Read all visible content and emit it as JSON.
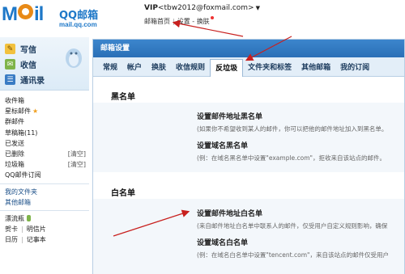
{
  "header": {
    "logo_text": "MAIL",
    "logo_qq": "QQ邮箱",
    "logo_domain": "mail.qq.com",
    "vip_label": "VIP",
    "account_email": "<tbw2012@foxmail.com>",
    "links": [
      "邮箱首页",
      "设置",
      "换肤"
    ]
  },
  "sidebar": {
    "quick": [
      "写信",
      "收信",
      "通讯录"
    ],
    "folders": [
      {
        "label": "收件箱"
      },
      {
        "label": "星标邮件",
        "star": "★"
      },
      {
        "label": "群邮件"
      },
      {
        "label": "草稿箱(11)"
      },
      {
        "label": "已发送"
      },
      {
        "label": "已删除",
        "action": "[清空]"
      },
      {
        "label": "垃圾箱",
        "action": "[清空]"
      },
      {
        "label": "QQ邮件订阅"
      }
    ],
    "my_folders": [
      "我的文件夹",
      "其他邮箱"
    ],
    "extras": {
      "drift": "漂流瓶",
      "card": "贺卡",
      "postcard": "明信片",
      "calendar": "日历",
      "notes": "记事本"
    }
  },
  "main": {
    "title": "邮箱设置",
    "tabs": [
      "常规",
      "帐户",
      "换肤",
      "收信规则",
      "反垃圾",
      "文件夹和标签",
      "其他邮箱",
      "我的订阅"
    ],
    "active_tab": "反垃圾",
    "blacklist": {
      "heading": "黑名单",
      "addr_title": "设置邮件地址黑名单",
      "addr_desc": "(如果你不希望收到某人的邮件，你可以把他的邮件地址加入到黑名单。",
      "domain_title": "设置域名黑名单",
      "domain_desc": "(例：在域名黑名单中设置\"example.com\"，拒收来自该站点的邮件。"
    },
    "whitelist": {
      "heading": "白名单",
      "addr_title": "设置邮件地址白名单",
      "addr_desc": "(来自邮件地址白名单中联系人的邮件，仅受用户自定义规则影响，确保",
      "domain_title": "设置域名白名单",
      "domain_desc": "(例：在域名白名单中设置\"tencent.com\"，来自该站点的邮件仅受用户"
    }
  },
  "colors": {
    "brand_blue": "#1e78c8",
    "logo_orange": "#e88a17",
    "title_bar": "#2a6fb7",
    "annotation_red": "#c8201e"
  }
}
